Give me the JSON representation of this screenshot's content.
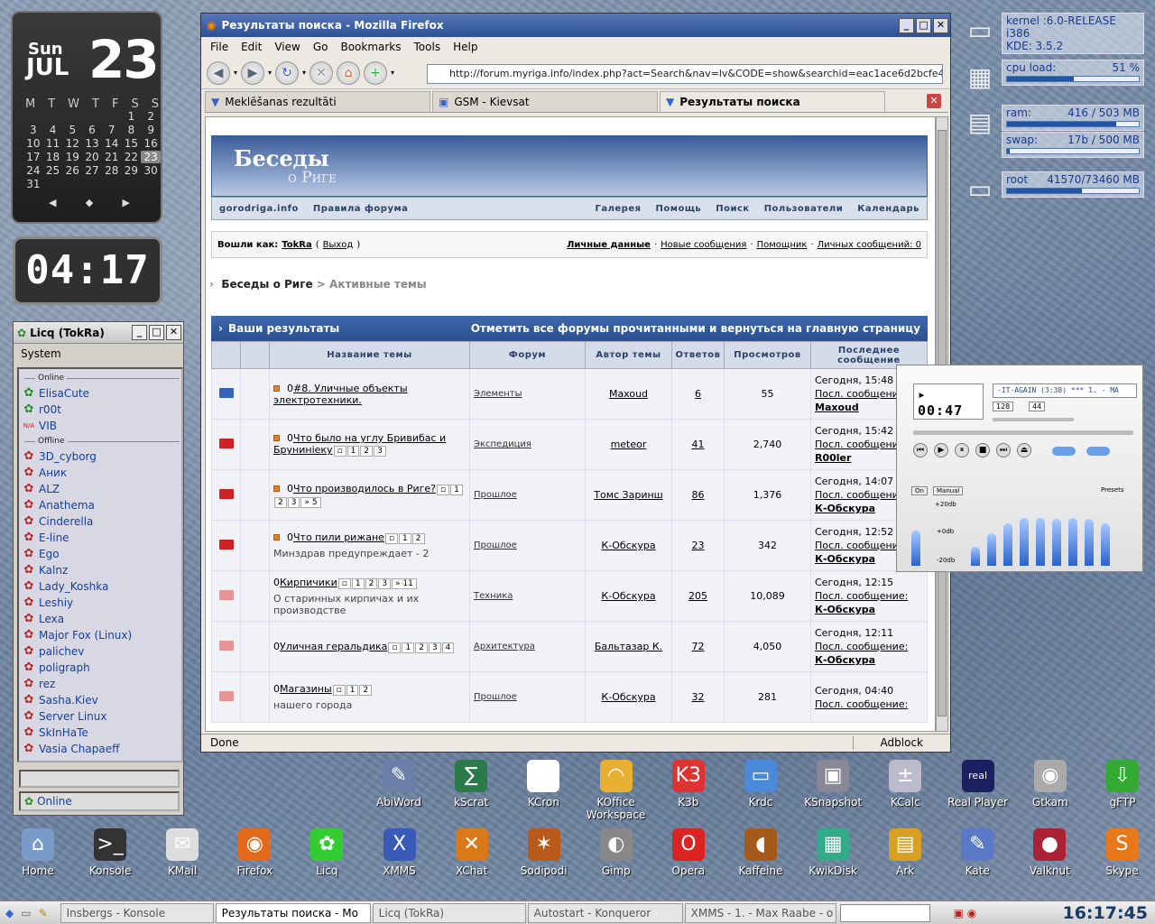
{
  "calendar": {
    "dow": "Sun",
    "month": "JUL",
    "day": "23",
    "weekdays": [
      "M",
      "T",
      "W",
      "T",
      "F",
      "S",
      "S"
    ],
    "weeks": [
      [
        "",
        "",
        "",
        "",
        "",
        "1",
        "2"
      ],
      [
        "3",
        "4",
        "5",
        "6",
        "7",
        "8",
        "9"
      ],
      [
        "10",
        "11",
        "12",
        "13",
        "14",
        "15",
        "16"
      ],
      [
        "17",
        "18",
        "19",
        "20",
        "21",
        "22",
        "23"
      ],
      [
        "24",
        "25",
        "26",
        "27",
        "28",
        "29",
        "30"
      ],
      [
        "31",
        "",
        "",
        "",
        "",
        "",
        ""
      ]
    ],
    "nav": [
      "◆",
      "◆",
      "◆"
    ]
  },
  "clock": "04:17",
  "licq": {
    "title": "Licq (TokRa)",
    "menu": "System",
    "online_label": "Online",
    "offline_label": "Offline",
    "online": [
      "ElisaCute",
      "r00t",
      "VIB"
    ],
    "offline": [
      "3D_cyborg",
      "Аник",
      "ALZ",
      "Anathema",
      "Cinderella",
      "E-line",
      "Ego",
      "Kalnz",
      "Lady_Koshka",
      "Leshiy",
      "Lexa",
      "Major Fox (Linux)",
      "palichev",
      "poligraph",
      "rez",
      "Sasha.Kiev",
      "Server Linux",
      "SkInHaTe",
      "Vasia Chapaeff"
    ],
    "status": "Online"
  },
  "monitors": [
    {
      "l1": "kernel :6.0-RELEASE i386",
      "l2": "KDE: 3.5.2"
    },
    {
      "label": "cpu load:",
      "value": "51 %",
      "fill": 0.51
    },
    {
      "label": "ram:",
      "value": "416 / 503 MB",
      "fill": 0.83
    },
    {
      "label": "swap:",
      "value": "17b / 500 MB",
      "fill": 0.02
    },
    {
      "label": "root",
      "value": "41570/73460 MB",
      "fill": 0.57
    }
  ],
  "firefox": {
    "title": "Результаты поиска - Mozilla Firefox",
    "menu": [
      "File",
      "Edit",
      "View",
      "Go",
      "Bookmarks",
      "Tools",
      "Help"
    ],
    "url": "http://forum.myriga.info/index.php?act=Search&nav=lv&CODE=show&searchid=eac1ace6d2bcfe4",
    "tabs": [
      "Meklēšanas rezultāti",
      "GSM - Kievsat",
      "Результаты поиска"
    ],
    "status": "Done",
    "adblock": "Adblock"
  },
  "forum": {
    "banner1": "Беседы",
    "banner2": "о Риге",
    "nav_left": [
      "gorodriga.info",
      "Правила форума"
    ],
    "nav_right": [
      "Галерея",
      "Помощь",
      "Поиск",
      "Пользователи",
      "Календарь"
    ],
    "login_prefix": "Вошли как:",
    "user": "TokRa",
    "logout": "Выход",
    "user_links": [
      "Личные данные",
      "Новые сообщения",
      "Помощник",
      "Личных сообщений: 0"
    ],
    "crumb1": "Беседы о Риге",
    "crumb2": "Активные темы",
    "results_title": "Ваши результаты",
    "results_action": "Отметить все форумы прочитанными и вернуться на главную страницу",
    "cols": [
      "Название темы",
      "Форум",
      "Автор темы",
      "Ответов",
      "Просмотров",
      "Последнее сообщение"
    ],
    "rows": [
      {
        "title": "#8. Уличные объекты электротехники.",
        "pages": [],
        "desc": "",
        "forum": "Элементы",
        "author": "Maxoud",
        "replies": "6",
        "views": "55",
        "time": "Сегодня, 15:48",
        "last": "Посл. сообщение:",
        "lastby": "Maxoud",
        "folder": "b",
        "dot": true
      },
      {
        "title": "Что было на углу Бривибас и Брунинieку",
        "pages": [
          "1",
          "2",
          "3"
        ],
        "desc": "",
        "forum": "Экспедиция",
        "author": "meteor",
        "replies": "41",
        "views": "2,740",
        "time": "Сегодня, 15:42",
        "last": "Посл. сообщение:",
        "lastby": "R00ler",
        "folder": "r",
        "dot": true
      },
      {
        "title": "Что производилось в Риге?",
        "pages": [
          "1",
          "2",
          "3",
          "» 5"
        ],
        "desc": "",
        "forum": "Прошлое",
        "author": "Томс Заринш",
        "replies": "86",
        "views": "1,376",
        "time": "Сегодня, 14:07",
        "last": "Посл. сообщение:",
        "lastby": "К-Обскура",
        "folder": "r",
        "dot": true
      },
      {
        "title": "Что пили рижане",
        "pages": [
          "1",
          "2"
        ],
        "desc": "Минздрав предупреждает - 2",
        "forum": "Прошлое",
        "author": "К-Обскура",
        "replies": "23",
        "views": "342",
        "time": "Сегодня, 12:52",
        "last": "Посл. сообщение:",
        "lastby": "К-Обскура",
        "folder": "r",
        "dot": true
      },
      {
        "title": "Кирпичики",
        "pages": [
          "1",
          "2",
          "3",
          "» 11"
        ],
        "desc": "О старинных кирпичах и их производстве",
        "forum": "Техника",
        "author": "К-Обскура",
        "replies": "205",
        "views": "10,089",
        "time": "Сегодня, 12:15",
        "last": "Посл. сообщение:",
        "lastby": "К-Обскура",
        "folder": "p",
        "dot": false
      },
      {
        "title": "Уличная геральдика",
        "pages": [
          "1",
          "2",
          "3",
          "4"
        ],
        "desc": "",
        "forum": "Архитектура",
        "author": "Бальтазар К.",
        "replies": "72",
        "views": "4,050",
        "time": "Сегодня, 12:11",
        "last": "Посл. сообщение:",
        "lastby": "К-Обскура",
        "folder": "p",
        "dot": false
      },
      {
        "title": "Магазины",
        "pages": [
          "1",
          "2"
        ],
        "desc": "нашего города",
        "forum": "Прошлое",
        "author": "К-Обскура",
        "replies": "32",
        "views": "281",
        "time": "Сегодня, 04:40",
        "last": "Посл. сообщение:",
        "lastby": "",
        "folder": "p",
        "dot": false
      }
    ]
  },
  "xmms": {
    "time": "00:47",
    "info": "-IT-AGAIN (3:38) *** 1. - MA",
    "kbps": "128",
    "khz": "44",
    "on": "On",
    "manual": "Manual",
    "presets": "Presets",
    "db_top": "+20db",
    "db_mid": "+0db",
    "db_bot": "-20db",
    "eq": [
      0.45,
      0.25,
      0.42,
      0.55,
      0.62,
      0.62,
      0.6,
      0.62,
      0.6,
      0.55
    ]
  },
  "desktop_row1": [
    {
      "name": "AbiWord",
      "color": "#6b7fa8",
      "glyph": "✎"
    },
    {
      "name": "kScrat",
      "color": "#2a7a4a",
      "glyph": "∑"
    },
    {
      "name": "KCron",
      "color": "#fff",
      "glyph": "◷"
    },
    {
      "name": "KOffice Workspace",
      "color": "#e8b030",
      "glyph": "◠"
    },
    {
      "name": "K3b",
      "color": "#d33",
      "glyph": "K3"
    },
    {
      "name": "Krdc",
      "color": "#4a8ad8",
      "glyph": "▭"
    },
    {
      "name": "KSnapshot",
      "color": "#889",
      "glyph": "▣"
    },
    {
      "name": "KCalc",
      "color": "#bbc",
      "glyph": "±"
    },
    {
      "name": "Real Player",
      "color": "#1a2060",
      "glyph": "real"
    },
    {
      "name": "Gtkam",
      "color": "#aaa",
      "glyph": "◉"
    },
    {
      "name": "gFTP",
      "color": "#3a3",
      "glyph": "⇩"
    }
  ],
  "desktop_row2": [
    {
      "name": "Home",
      "color": "#7a9ac8",
      "glyph": "⌂"
    },
    {
      "name": "Konsole",
      "color": "#333",
      "glyph": ">_"
    },
    {
      "name": "KMail",
      "color": "#ddd",
      "glyph": "✉"
    },
    {
      "name": "Firefox",
      "color": "#e26a1a",
      "glyph": "◉"
    },
    {
      "name": "Licq",
      "color": "#3c3",
      "glyph": "✿"
    },
    {
      "name": "XMMS",
      "color": "#3a5ab8",
      "glyph": "X"
    },
    {
      "name": "XChat",
      "color": "#d87a1a",
      "glyph": "✕"
    },
    {
      "name": "Sodipodi",
      "color": "#b85a1a",
      "glyph": "✶"
    },
    {
      "name": "Gimp",
      "color": "#888",
      "glyph": "◐"
    },
    {
      "name": "Opera",
      "color": "#d22",
      "glyph": "O"
    },
    {
      "name": "Kaffeine",
      "color": "#a55a1a",
      "glyph": "◖"
    },
    {
      "name": "KwikDisk",
      "color": "#3a8",
      "glyph": "▦"
    },
    {
      "name": "Ark",
      "color": "#d8a020",
      "glyph": "▤"
    },
    {
      "name": "Kate",
      "color": "#5a7ac8",
      "glyph": "✎"
    },
    {
      "name": "Valknut",
      "color": "#a23",
      "glyph": "●"
    },
    {
      "name": "Skype",
      "color": "#e8781a",
      "glyph": "S"
    }
  ],
  "taskbar": {
    "items": [
      "Insbergs - Konsole",
      "Результаты поиска - Mo",
      "Licq (TokRa)",
      "Autostart - Konqueror",
      "XMMS - 1. - Max Raabe - o"
    ],
    "clock": "16:17:45"
  }
}
